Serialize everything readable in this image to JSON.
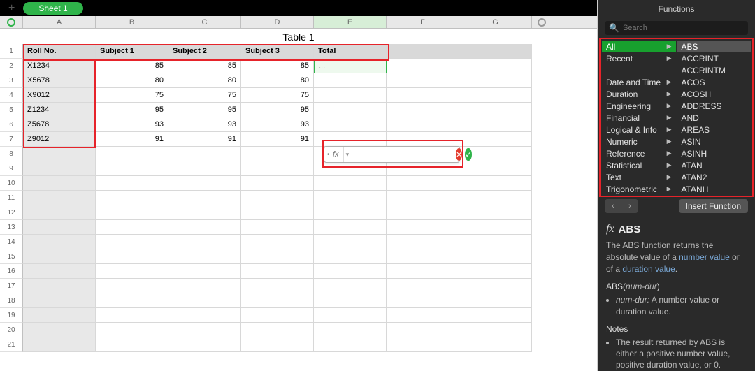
{
  "tabs": {
    "sheet1": "Sheet 1"
  },
  "table": {
    "title": "Table 1"
  },
  "columns": [
    "A",
    "B",
    "C",
    "D",
    "E",
    "F",
    "G"
  ],
  "headers": {
    "c1": "Roll No.",
    "c2": "Subject 1",
    "c3": "Subject 2",
    "c4": "Subject 3",
    "c5": "Total"
  },
  "rows": [
    {
      "roll": "X1234",
      "s1": 85,
      "s2": 85,
      "s3": 85,
      "total": "..."
    },
    {
      "roll": "X5678",
      "s1": 80,
      "s2": 80,
      "s3": 80,
      "total": ""
    },
    {
      "roll": "X9012",
      "s1": 75,
      "s2": 75,
      "s3": 75,
      "total": ""
    },
    {
      "roll": "Z1234",
      "s1": 95,
      "s2": 95,
      "s3": 95,
      "total": ""
    },
    {
      "roll": "Z5678",
      "s1": 93,
      "s2": 93,
      "s3": 93,
      "total": ""
    },
    {
      "roll": "Z9012",
      "s1": 91,
      "s2": 91,
      "s3": 91,
      "total": ""
    }
  ],
  "row_numbers": [
    "1",
    "2",
    "3",
    "4",
    "5",
    "6",
    "7",
    "8",
    "9",
    "10",
    "11",
    "12",
    "13",
    "14",
    "15",
    "16",
    "17",
    "18",
    "19",
    "20",
    "21"
  ],
  "formula_bar": {
    "fx": "fx",
    "value": "",
    "cancel": "✕",
    "accept": "✓"
  },
  "functions_panel": {
    "title": "Functions",
    "search_placeholder": "Search",
    "categories": [
      "All",
      "Recent",
      "",
      "Date and Time",
      "Duration",
      "Engineering",
      "Financial",
      "Logical & Info",
      "Numeric",
      "Reference",
      "Statistical",
      "Text",
      "Trigonometric"
    ],
    "functions": [
      "ABS",
      "ACCRINT",
      "ACCRINTM",
      "ACOS",
      "ACOSH",
      "ADDRESS",
      "AND",
      "AREAS",
      "ASIN",
      "ASINH",
      "ATAN",
      "ATAN2",
      "ATANH"
    ],
    "insert_label": "Insert Function",
    "back": "‹",
    "forward": "›",
    "selected_category": "All",
    "selected_function": "ABS",
    "doc": {
      "name": "ABS",
      "desc_prefix": "The ABS function returns the absolute value of a ",
      "link1": "number value",
      "desc_mid": " or of a ",
      "link2": "duration value",
      "desc_suffix": ".",
      "signature_fn": "ABS",
      "signature_arg": "num-dur",
      "arg_name": "num-dur:",
      "arg_desc": " A number value or duration value.",
      "notes_h": "Notes",
      "note1": "The result returned by ABS is either a positive number value, positive duration value, or 0."
    }
  }
}
